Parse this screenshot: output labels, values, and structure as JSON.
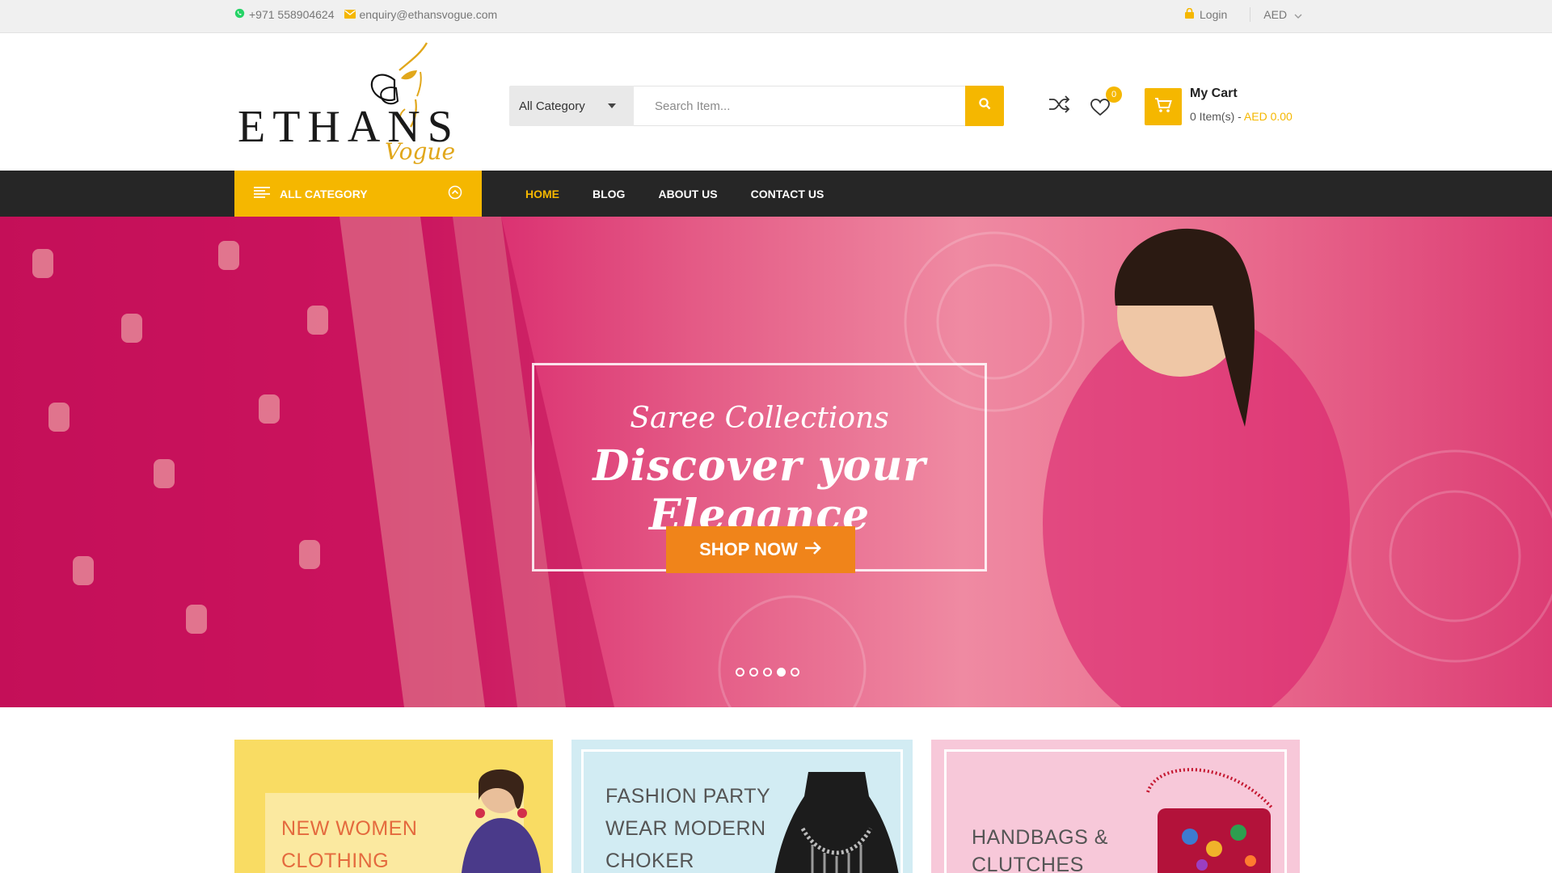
{
  "topbar": {
    "phone": "+971 558904624",
    "email": "enquiry@ethansvogue.com",
    "login": "Login",
    "currency": "AED"
  },
  "header": {
    "logo_text": "ETHANS",
    "logo_sub": "Vogue",
    "search": {
      "category": "All Category",
      "placeholder": "Search Item..."
    },
    "wishlist_count": "0",
    "cart": {
      "title": "My Cart",
      "items": "0 Item(s) - ",
      "amount": "AED 0.00"
    }
  },
  "nav": {
    "all_category": "ALL CATEGORY",
    "items": [
      "HOME",
      "BLOG",
      "ABOUT US",
      "CONTACT US"
    ]
  },
  "hero": {
    "subtitle": "Saree Collections",
    "title": "Discover your Elegance",
    "button": "SHOP NOW",
    "slide_count": 5,
    "active_slide": 4
  },
  "promos": [
    {
      "line1": "NEW WOMEN",
      "line2": "CLOTHING"
    },
    {
      "line1": "FASHION PARTY",
      "line2": "WEAR MODERN",
      "line3": "CHOKER"
    },
    {
      "line1": "HANDBAGS &",
      "line2": "CLUTCHES"
    }
  ],
  "colors": {
    "accent": "#f5b700",
    "nav_bg": "#262626",
    "shop_button": "#f0841a"
  },
  "icons": [
    "whatsapp-icon",
    "mail-icon",
    "lock-icon",
    "chevron-down-icon",
    "search-icon",
    "shuffle-icon",
    "heart-icon",
    "cart-icon",
    "menu-icon"
  ]
}
